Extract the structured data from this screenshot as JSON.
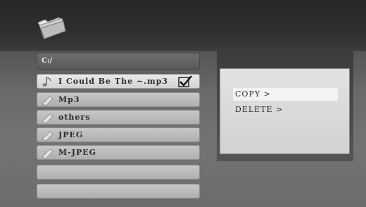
{
  "header": {
    "icon": "folder-icon"
  },
  "file_list": {
    "path": "C:/",
    "items": [
      {
        "label": "I Could Be The ~.mp3",
        "icon": "music-note-icon",
        "selected": true,
        "checked": true
      },
      {
        "label": "Mp3",
        "icon": "folder-icon",
        "selected": false,
        "checked": false
      },
      {
        "label": "others",
        "icon": "folder-icon",
        "selected": false,
        "checked": false
      },
      {
        "label": "JPEG",
        "icon": "folder-icon",
        "selected": false,
        "checked": false
      },
      {
        "label": "M-JPEG",
        "icon": "folder-icon",
        "selected": false,
        "checked": false
      },
      {
        "label": "",
        "icon": "",
        "selected": false,
        "checked": false
      },
      {
        "label": "",
        "icon": "",
        "selected": false,
        "checked": false
      }
    ]
  },
  "context_menu": {
    "items": [
      {
        "label": "COPY >",
        "highlighted": true
      },
      {
        "label": "DELETE >",
        "highlighted": false
      }
    ]
  },
  "colors": {
    "highlight": "#f3f3f3",
    "row": "#bdbdbd",
    "text": "#2c2c2c"
  }
}
